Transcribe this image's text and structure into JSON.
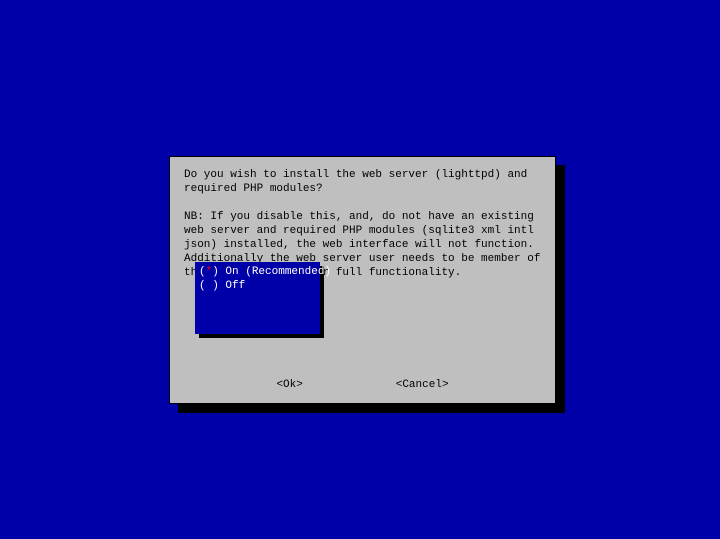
{
  "question": "Do you wish to install the web server (lighttpd) and required PHP modules?",
  "note": "NB: If you disable this, and, do not have an existing web server and required PHP modules (sqlite3 xml intl json) installed, the web interface will not function. Additionally the web server user needs to be member of the \"pihole\" group for full functionality.",
  "options": [
    {
      "marker": "*",
      "label": "On (Recommended)",
      "selected": true
    },
    {
      "marker": " ",
      "label": "Off",
      "selected": false
    }
  ],
  "buttons": {
    "ok": "<Ok>",
    "cancel": "<Cancel>"
  }
}
